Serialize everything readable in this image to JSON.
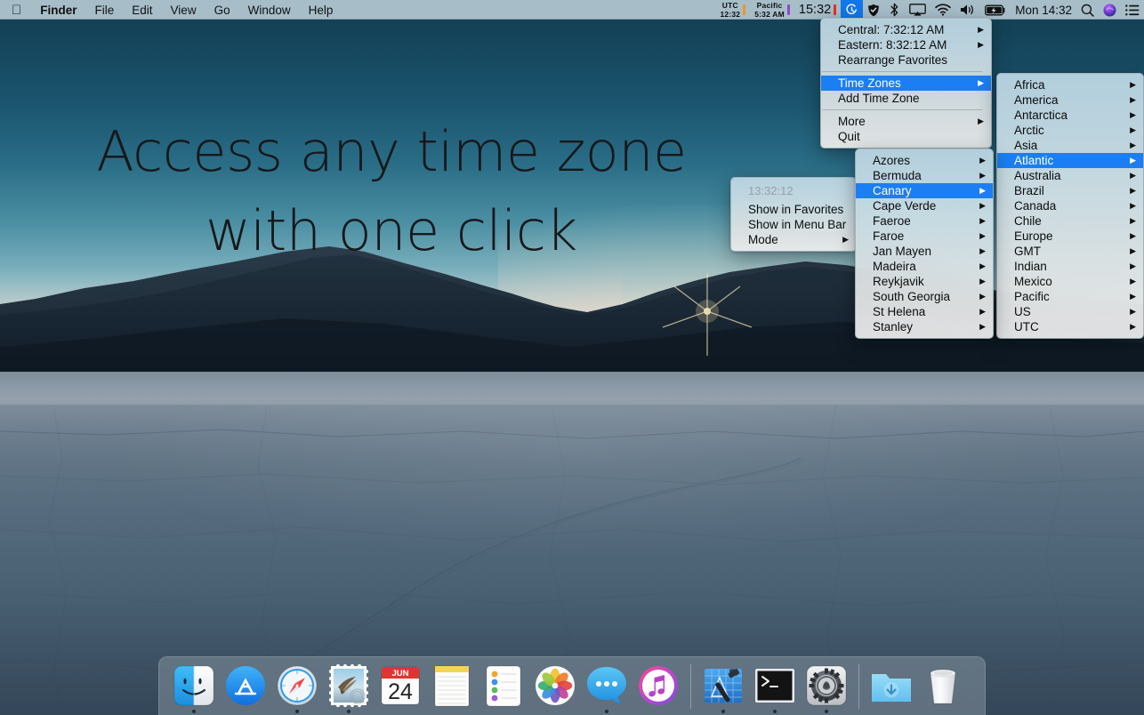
{
  "menubar": {
    "apple_icon": "apple-logo",
    "app_name": "Finder",
    "items": [
      "File",
      "Edit",
      "View",
      "Go",
      "Window",
      "Help"
    ],
    "status": {
      "utc_label": "UTC",
      "utc_time": "12:32",
      "utc_color": "#f0932a",
      "pacific_label": "Pacific",
      "pacific_time": "5:32 AM",
      "pacific_color": "#8a4ad0",
      "local_time": "15:32",
      "local_color": "#e0322a",
      "clock_icon": "world-clock-icon",
      "shield_icon": "shield-check-icon",
      "bluetooth_icon": "bluetooth-icon",
      "airplay_icon": "airplay-screen-icon",
      "wifi_icon": "wifi-icon",
      "volume_icon": "speaker-volume-icon",
      "battery_icon": "battery-charging-icon",
      "datetime": "Mon 14:32",
      "search_icon": "spotlight-search-icon",
      "siri_icon": "siri-icon",
      "controlcenter_icon": "notification-center-icon"
    }
  },
  "desktop": {
    "headline_line1": "Access any time zone",
    "headline_line2": "with one click"
  },
  "menu_root": {
    "items": [
      {
        "label": "Central: 7:32:12 AM",
        "arrow": true,
        "selected": false,
        "sep_after": false
      },
      {
        "label": "Eastern: 8:32:12 AM",
        "arrow": true,
        "selected": false,
        "sep_after": false
      },
      {
        "label": "Rearrange Favorites",
        "arrow": false,
        "selected": false,
        "sep_after": true
      },
      {
        "label": "Time Zones",
        "arrow": true,
        "selected": true,
        "sep_after": false
      },
      {
        "label": "Add Time Zone",
        "arrow": false,
        "selected": false,
        "sep_after": true
      },
      {
        "label": "More",
        "arrow": true,
        "selected": false,
        "sep_after": false
      },
      {
        "label": "Quit",
        "arrow": false,
        "selected": false,
        "sep_after": false
      }
    ]
  },
  "menu_clock": {
    "header_time": "13:32:12",
    "items": [
      {
        "label": "Show in Favorites",
        "arrow": false,
        "selected": false
      },
      {
        "label": "Show in Menu Bar",
        "arrow": false,
        "selected": false
      },
      {
        "label": "Mode",
        "arrow": true,
        "selected": false
      }
    ]
  },
  "menu_regions": {
    "items": [
      {
        "label": "Africa",
        "arrow": true,
        "selected": false
      },
      {
        "label": "America",
        "arrow": true,
        "selected": false
      },
      {
        "label": "Antarctica",
        "arrow": true,
        "selected": false
      },
      {
        "label": "Arctic",
        "arrow": true,
        "selected": false
      },
      {
        "label": "Asia",
        "arrow": true,
        "selected": false
      },
      {
        "label": "Atlantic",
        "arrow": true,
        "selected": true
      },
      {
        "label": "Australia",
        "arrow": true,
        "selected": false
      },
      {
        "label": "Brazil",
        "arrow": true,
        "selected": false
      },
      {
        "label": "Canada",
        "arrow": true,
        "selected": false
      },
      {
        "label": "Chile",
        "arrow": true,
        "selected": false
      },
      {
        "label": "Europe",
        "arrow": true,
        "selected": false
      },
      {
        "label": "GMT",
        "arrow": true,
        "selected": false
      },
      {
        "label": "Indian",
        "arrow": true,
        "selected": false
      },
      {
        "label": "Mexico",
        "arrow": true,
        "selected": false
      },
      {
        "label": "Pacific",
        "arrow": true,
        "selected": false
      },
      {
        "label": "US",
        "arrow": true,
        "selected": false
      },
      {
        "label": "UTC",
        "arrow": true,
        "selected": false
      }
    ]
  },
  "menu_atlantic": {
    "items": [
      {
        "label": "Azores",
        "arrow": true,
        "selected": false
      },
      {
        "label": "Bermuda",
        "arrow": true,
        "selected": false
      },
      {
        "label": "Canary",
        "arrow": true,
        "selected": true
      },
      {
        "label": "Cape Verde",
        "arrow": true,
        "selected": false
      },
      {
        "label": "Faeroe",
        "arrow": true,
        "selected": false
      },
      {
        "label": "Faroe",
        "arrow": true,
        "selected": false
      },
      {
        "label": "Jan Mayen",
        "arrow": true,
        "selected": false
      },
      {
        "label": "Madeira",
        "arrow": true,
        "selected": false
      },
      {
        "label": "Reykjavik",
        "arrow": true,
        "selected": false
      },
      {
        "label": "South Georgia",
        "arrow": true,
        "selected": false
      },
      {
        "label": "St Helena",
        "arrow": true,
        "selected": false
      },
      {
        "label": "Stanley",
        "arrow": true,
        "selected": false
      }
    ]
  },
  "dock": {
    "items": [
      {
        "name": "finder",
        "label": "Finder",
        "running": true
      },
      {
        "name": "app-store",
        "label": "App Store",
        "running": false
      },
      {
        "name": "safari",
        "label": "Safari",
        "running": true
      },
      {
        "name": "mail",
        "label": "Mail",
        "running": true
      },
      {
        "name": "calendar",
        "label": "Calendar",
        "running": false,
        "month": "JUN",
        "day": "24"
      },
      {
        "name": "notes",
        "label": "Notes",
        "running": false
      },
      {
        "name": "reminders",
        "label": "Reminders",
        "running": false
      },
      {
        "name": "photos",
        "label": "Photos",
        "running": false
      },
      {
        "name": "messages",
        "label": "Messages",
        "running": true
      },
      {
        "name": "music",
        "label": "Music",
        "running": false
      },
      {
        "name": "separator",
        "label": "",
        "running": false
      },
      {
        "name": "xcode",
        "label": "Xcode",
        "running": true
      },
      {
        "name": "terminal",
        "label": "Terminal",
        "running": true
      },
      {
        "name": "system-preferences",
        "label": "System Preferences",
        "running": true
      },
      {
        "name": "separator",
        "label": "",
        "running": false
      },
      {
        "name": "downloads-folder",
        "label": "Downloads",
        "running": false
      },
      {
        "name": "trash",
        "label": "Trash",
        "running": false
      }
    ]
  }
}
